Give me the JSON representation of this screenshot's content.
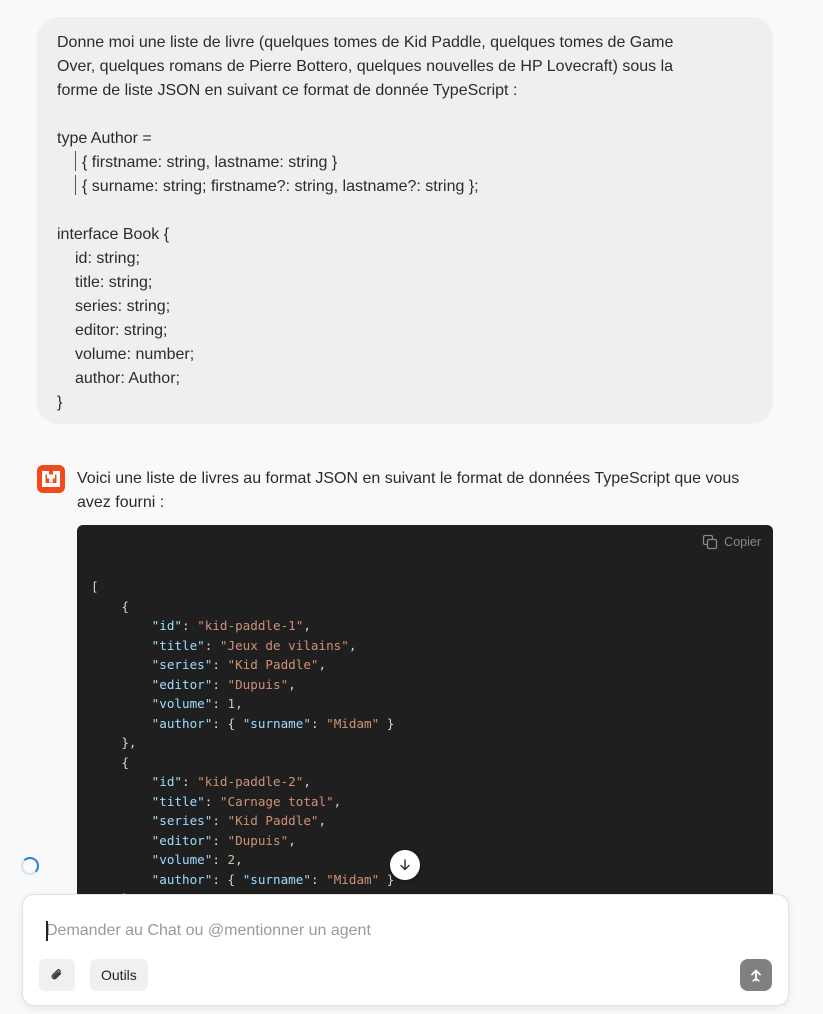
{
  "user_message": {
    "lines": [
      "Donne moi une liste de livre (quelques tomes de Kid Paddle, quelques tomes de Game",
      "Over, quelques romans de Pierre Bottero, quelques nouvelles de HP Lovecraft) sous la",
      "forme de liste JSON en suivant ce format de donnée TypeScript :",
      "",
      "type Author =",
      "| { firstname: string, lastname: string }",
      "| { surname: string; firstname?: string, lastname?: string };",
      "",
      "interface Book {",
      "id: string;",
      "title: string;",
      "series: string;",
      "editor: string;",
      "volume: number;",
      "author: Author;",
      "}"
    ]
  },
  "assistant": {
    "avatar_icon": "brand-logo-icon",
    "intro": "Voici une liste de livres au format JSON en suivant le format de données TypeScript que vous avez fourni :",
    "code": {
      "copy_label": "Copier",
      "open_bracket": "[",
      "books": [
        {
          "id": "\"kid-paddle-1\"",
          "title": "\"Jeux de vilains\"",
          "series": "\"Kid Paddle\"",
          "editor": "\"Dupuis\"",
          "volume": "1",
          "surname": "\"Midam\""
        },
        {
          "id": "\"kid-paddle-2\"",
          "title": "\"Carnage total\"",
          "series": "\"Kid Paddle\"",
          "editor": "\"Dupuis\"",
          "volume": "2",
          "surname": "\"Midam\""
        }
      ]
    }
  },
  "composer": {
    "placeholder": "Demander au Chat ou @mentionner un agent",
    "tools_label": "Outils"
  },
  "colors": {
    "brand": "#f04a1e",
    "code_bg": "#1f1f1f",
    "code_key": "#9cdcfe",
    "code_string": "#ce9178",
    "code_number": "#b5cea8"
  }
}
